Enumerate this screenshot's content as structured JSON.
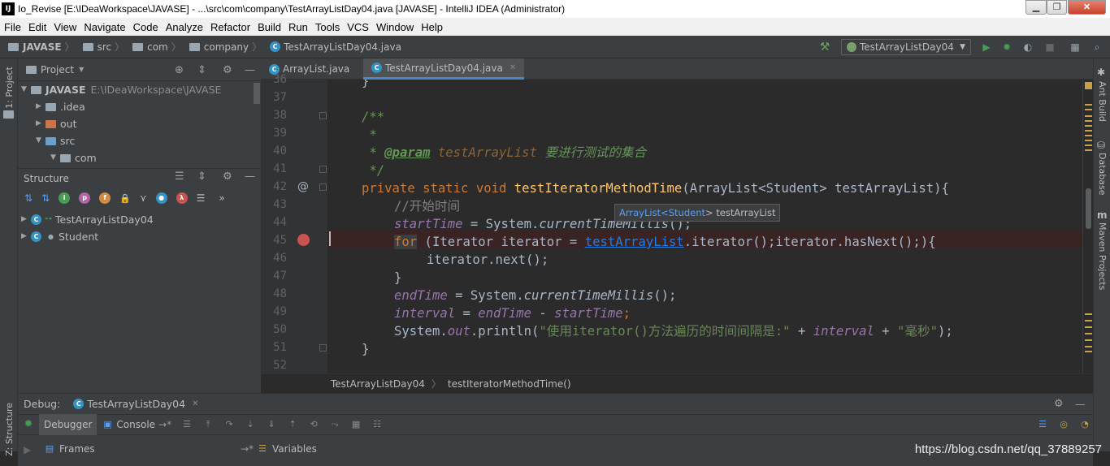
{
  "window": {
    "title": "Io_Revise [E:\\IDeaWorkspace\\JAVASE] - ...\\src\\com\\company\\TestArrayListDay04.java [JAVASE] - IntelliJ IDEA (Administrator)",
    "logo": "IJ"
  },
  "menu": [
    "File",
    "Edit",
    "View",
    "Navigate",
    "Code",
    "Analyze",
    "Refactor",
    "Build",
    "Run",
    "Tools",
    "VCS",
    "Window",
    "Help"
  ],
  "navbar": {
    "crumbs": [
      "JAVASE",
      "src",
      "com",
      "company",
      "TestArrayListDay04.java"
    ],
    "run_config": "TestArrayListDay04"
  },
  "left_stripe": {
    "top": "1: Project",
    "bottom": "Z: Structure"
  },
  "project": {
    "title": "Project",
    "tree": [
      {
        "label": "JAVASE",
        "path": "E:\\IDeaWorkspace\\JAVASE"
      },
      {
        "label": ".idea"
      },
      {
        "label": "out"
      },
      {
        "label": "src"
      },
      {
        "label": "com"
      }
    ]
  },
  "structure": {
    "title": "Structure",
    "items": [
      "TestArrayListDay04",
      "Student"
    ]
  },
  "tabs": [
    {
      "label": "ArrayList.java"
    },
    {
      "label": "TestArrayListDay04.java"
    }
  ],
  "line_numbers": [
    "36",
    "37",
    "38",
    "39",
    "40",
    "41",
    "42",
    "43",
    "44",
    "45",
    "46",
    "47",
    "48",
    "49",
    "50",
    "51",
    "52"
  ],
  "code": {
    "l36": "}",
    "l38": "/**",
    "l39": " *",
    "l40_tag": "@param",
    "l40_param": "testArrayList",
    "l40_desc": "要进行测试的集合",
    "l41": " */",
    "l42_kw": "private static void ",
    "l42_fn": "testIteratorMethodTime",
    "l42_rest": "(ArrayList<Student> testArrayList){",
    "l43": "//开始时间",
    "l44_fld": "startTime",
    "l44_mid": " = System.",
    "l44_call": "currentTimeMillis",
    "l44_end": "();",
    "l45_kw": "for",
    "l45_a": " (Iterator iterator = ",
    "l45_link": "testArrayList",
    "l45_b": ".iterator();iterator.hasNext();){",
    "l46": "iterator.next();",
    "l47": "}",
    "l48_fld": "endTime",
    "l48_mid": " = System.",
    "l48_call": "currentTimeMillis",
    "l48_end": "();",
    "l49_a": "interval",
    "l49_b": "endTime",
    "l49_c": "startTime",
    "l50_a": "System.",
    "l50_out": "out",
    "l50_b": ".println(",
    "l50_str1": "\"使用iterator()方法遍历的时间间隔是:\"",
    "l50_plus1": " + ",
    "l50_fld": "interval",
    "l50_plus2": " + ",
    "l50_str2": "\"毫秒\"",
    "l50_end": ");",
    "l51": "}"
  },
  "hint": {
    "a": "ArrayList<",
    "b": "Student",
    "c": "> testArrayList"
  },
  "editor_breadcrumb": [
    "TestArrayListDay04",
    "testIteratorMethodTime()"
  ],
  "right_stripe": [
    "Ant Build",
    "Database",
    "Maven Projects"
  ],
  "debug": {
    "label": "Debug:",
    "session": "TestArrayListDay04",
    "tabs": [
      "Debugger",
      "Console"
    ],
    "frames": "Frames",
    "variables": "Variables"
  },
  "watermark": "https://blog.csdn.net/qq_37889257",
  "colors": {
    "accent": "#4a88c7",
    "breakpoint": "#c75450",
    "run_green": "#499c54",
    "keyword": "#cc7832",
    "string": "#6a8759"
  }
}
